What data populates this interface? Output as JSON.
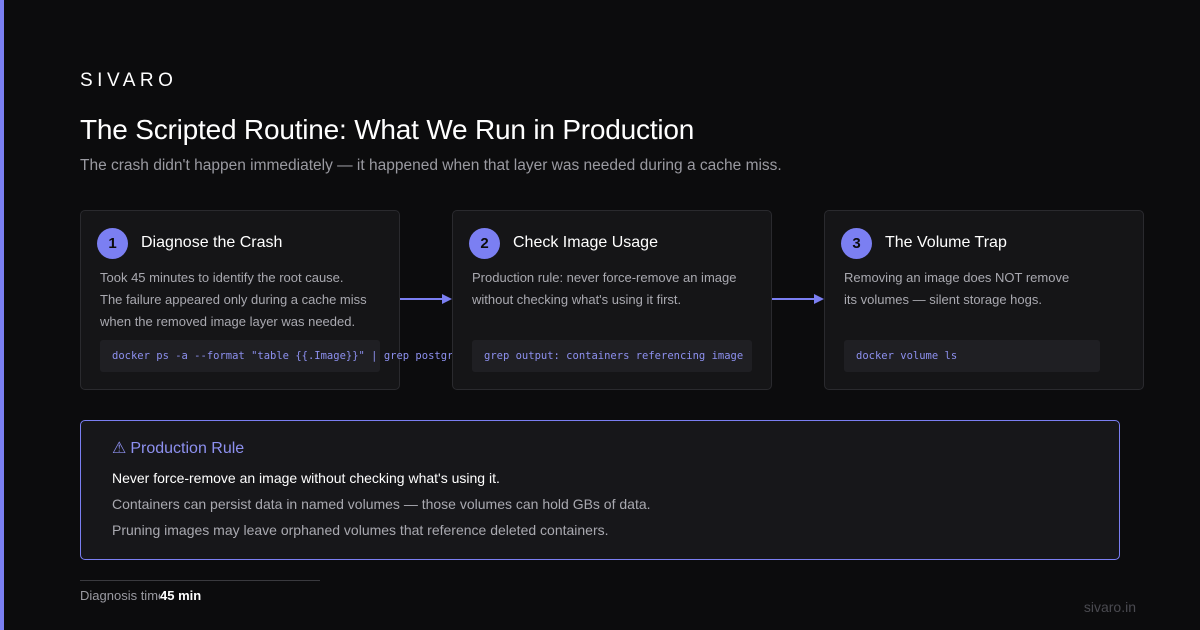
{
  "brand": "SIVARO",
  "title": "The Scripted Routine: What We Run in Production",
  "subtitle": "The crash didn't happen immediately — it happened when that layer was needed during a cache miss.",
  "colors": {
    "accent": "#7b7ff2",
    "background": "#0c0c0d",
    "card": "#151517"
  },
  "steps": [
    {
      "number": "1",
      "title": "Diagnose the Crash",
      "lines": [
        "Took 45 minutes to identify the root cause.",
        "The failure appeared only during a cache miss",
        "when the removed image layer was needed."
      ],
      "code": "docker ps -a --format \"table {{.Image}}\" | grep postgres"
    },
    {
      "number": "2",
      "title": "Check Image Usage",
      "lines": [
        "Production rule: never force-remove an image",
        "without checking what's using it first."
      ],
      "code": "grep output: containers referencing image"
    },
    {
      "number": "3",
      "title": "The Volume Trap",
      "lines": [
        "Removing an image does NOT remove",
        "its volumes — silent storage hogs."
      ],
      "code": "docker volume ls"
    }
  ],
  "rule": {
    "icon": "warning-icon",
    "warn_glyph": "⚠",
    "title": "Production Rule",
    "line1": "Never force-remove an image without checking what's using it.",
    "line2": "Containers can persist data in named volumes — those volumes can hold GBs of data.",
    "line3": "Pruning images may leave orphaned volumes that reference deleted containers."
  },
  "metric": {
    "label": "Diagnosis time",
    "value": "45 min"
  },
  "footer_url": "sivaro.in"
}
